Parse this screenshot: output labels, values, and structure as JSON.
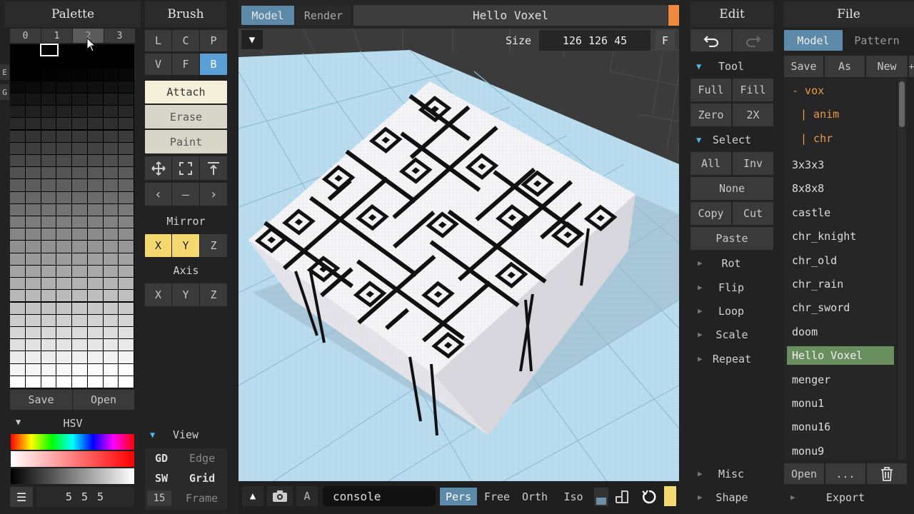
{
  "palette": {
    "title": "Palette",
    "tabs": [
      "0",
      "1",
      "2",
      "3"
    ],
    "side_tabs": [
      "E",
      "G"
    ],
    "save": "Save",
    "open": "Open",
    "hsv_label": "HSV",
    "color_value": "5 5 5"
  },
  "brush": {
    "title": "Brush",
    "row1": [
      "L",
      "C",
      "P"
    ],
    "row2": [
      "V",
      "F",
      "B"
    ],
    "modes": [
      "Attach",
      "Erase",
      "Paint"
    ],
    "nav_row": [
      "‹",
      "–",
      "›"
    ],
    "mirror_label": "Mirror",
    "mirror": [
      "X",
      "Y",
      "Z"
    ],
    "axis_label": "Axis",
    "axis": [
      "X",
      "Y",
      "Z"
    ]
  },
  "view": {
    "label": "View",
    "rows": [
      {
        "key": "GD",
        "val": "Edge"
      },
      {
        "key": "SW",
        "val": "Grid"
      },
      {
        "key": "15",
        "val": "Frame"
      }
    ]
  },
  "top": {
    "tab_model": "Model",
    "tab_render": "Render",
    "title": "Hello Voxel",
    "size_label": "Size",
    "size_value": "126 126 45",
    "f_btn": "F"
  },
  "bottom": {
    "a_btn": "A",
    "console": "console",
    "views": [
      "Pers",
      "Free",
      "Orth",
      "Iso"
    ]
  },
  "edit": {
    "title": "Edit",
    "tool_label": "Tool",
    "tool_btns": [
      "Full",
      "Fill",
      "Zero",
      "2X"
    ],
    "select_label": "Select",
    "select_btns": [
      "All",
      "Inv"
    ],
    "none": "None",
    "copy": "Copy",
    "cut": "Cut",
    "paste": "Paste",
    "ops": [
      "Rot",
      "Flip",
      "Loop",
      "Scale",
      "Repeat"
    ],
    "misc": "Misc",
    "shape": "Shape"
  },
  "file": {
    "title": "File",
    "tab_model": "Model",
    "tab_pattern": "Pattern",
    "save": "Save",
    "as": "As",
    "new": "New",
    "plus": "+",
    "tree": [
      "- vox",
      "| anim",
      "| chr"
    ],
    "items": [
      "3x3x3",
      "8x8x8",
      "castle",
      "chr_knight",
      "chr_old",
      "chr_rain",
      "chr_sword",
      "doom",
      "Hello Voxel",
      "menger",
      "monu1",
      "monu16",
      "monu9"
    ],
    "selected": "Hello Voxel",
    "open": "Open",
    "dots": "...",
    "export": "Export"
  },
  "colors": {
    "accent_yellow": "#f4d971",
    "accent_blue": "#4cb4e8",
    "selected_green": "#6a8f5e",
    "tree_orange": "#e99a4a",
    "orange_bar": "#f0883e"
  }
}
